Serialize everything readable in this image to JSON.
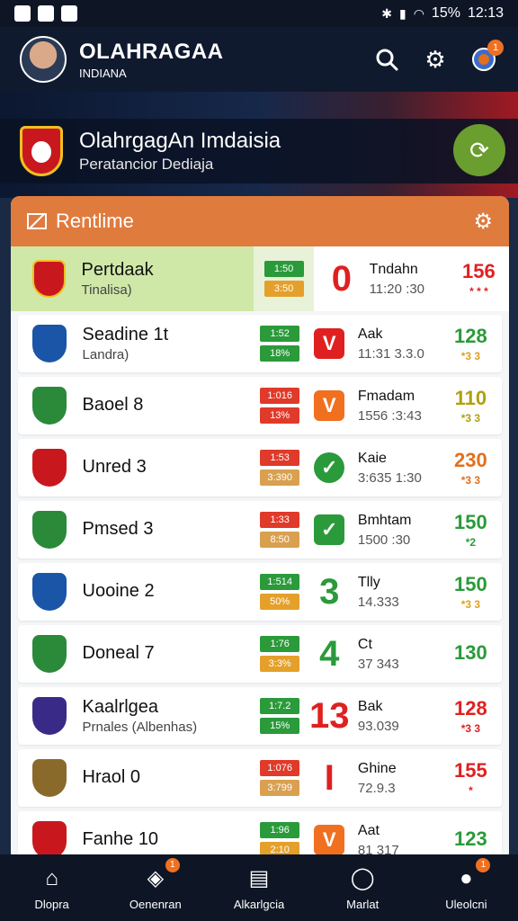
{
  "status_bar": {
    "time": "12:13",
    "battery": "15%"
  },
  "header": {
    "title": "OLAHRAGAA",
    "subtitle": "INDIANA",
    "notification_count": "1",
    "icons": [
      "search-icon",
      "gear-icon",
      "profile-icon"
    ]
  },
  "hero": {
    "title": "OlahrgagAn Imdaisia",
    "subtitle": "Peratancior Dediaja"
  },
  "panel": {
    "title": "Rentlime",
    "featured": {
      "team": "Pertdaak",
      "sub": "Tinalisa)",
      "pill_top": "1:50",
      "pill_bottom": "3:50",
      "indicator": "0",
      "opponent": "Tndahn",
      "opponent_sub": "11:20 :30",
      "score": "156",
      "score_sub": "* * *",
      "color": "#e02020"
    },
    "rows": [
      {
        "team": "Seadine 1t",
        "sub": "Landra)",
        "pill_top": "1:52",
        "pill_bottom": "18%",
        "indicator_type": "box",
        "indicator": "V",
        "opponent": "Aak",
        "opponent_sub": "11:31 3.3.0",
        "score": "128",
        "score_sub": "*3 3",
        "color": "#2a9a3a",
        "badge": "#1a55a8"
      },
      {
        "team": "Baoel 8",
        "sub": "",
        "pill_top": "1:016",
        "pill_bottom": "13%",
        "indicator_type": "box",
        "indicator": "V",
        "opponent": "Fmadam",
        "opponent_sub": "1556 :3:43",
        "score": "110",
        "score_sub": "*3 3",
        "color": "#b0a010",
        "badge": "#2a8a3a"
      },
      {
        "team": "Unred 3",
        "sub": "",
        "pill_top": "1:53",
        "pill_bottom": "3:390",
        "indicator_type": "circle",
        "indicator": "✓",
        "opponent": "Kaie",
        "opponent_sub": "3:635 1:30",
        "score": "230",
        "score_sub": "*3 3",
        "color": "#e07020",
        "badge": "#c8181e"
      },
      {
        "team": "Pmsed 3",
        "sub": "",
        "pill_top": "1:33",
        "pill_bottom": "8:50",
        "indicator_type": "box",
        "indicator": "✓",
        "opponent": "Bmhtam",
        "opponent_sub": "1500 :30",
        "score": "150",
        "score_sub": "*2",
        "color": "#2a9a3a",
        "badge": "#2a8a3a"
      },
      {
        "team": "Uooine 2",
        "sub": "",
        "pill_top": "1:514",
        "pill_bottom": "50%",
        "indicator_type": "num",
        "indicator": "3",
        "opponent": "Tlly",
        "opponent_sub": "14.333",
        "score": "150",
        "score_sub": "*3 3",
        "color": "#2a9a3a",
        "badge": "#1a55a8"
      },
      {
        "team": "Doneal 7",
        "sub": "",
        "pill_top": "1:76",
        "pill_bottom": "3:3%",
        "indicator_type": "num",
        "indicator": "4",
        "opponent": "Ct",
        "opponent_sub": "37 343",
        "score": "130",
        "score_sub": "",
        "color": "#2a9a3a",
        "badge": "#2a8a3a"
      },
      {
        "team": "Kaalrlgea",
        "sub": "Prnales (Albenhas)",
        "pill_top": "1:7.2",
        "pill_bottom": "15%",
        "indicator_type": "num",
        "indicator": "13",
        "opponent": "Bak",
        "opponent_sub": "93.039",
        "score": "128",
        "score_sub": "*3 3",
        "color": "#e02020",
        "badge": "#3a2a88"
      },
      {
        "team": "Hraol 0",
        "sub": "",
        "pill_top": "1:076",
        "pill_bottom": "3:799",
        "indicator_type": "num",
        "indicator": "I",
        "opponent": "Ghine",
        "opponent_sub": "72.9.3",
        "score": "155",
        "score_sub": "*",
        "color": "#e02020",
        "badge": "#8a6a2a"
      },
      {
        "team": "Fanhe 10",
        "sub": "",
        "pill_top": "1:96",
        "pill_bottom": "2:10",
        "indicator_type": "box",
        "indicator": "V",
        "opponent": "Aat",
        "opponent_sub": "81 317",
        "score": "123",
        "score_sub": "",
        "color": "#2a9a3a",
        "badge": "#c8181e"
      }
    ]
  },
  "nav": [
    {
      "label": "Dlopra",
      "icon": "home-icon",
      "badge": ""
    },
    {
      "label": "Oenenran",
      "icon": "shield-icon",
      "badge": "1"
    },
    {
      "label": "Alkarlgcia",
      "icon": "chart-icon",
      "badge": ""
    },
    {
      "label": "Marlat",
      "icon": "person-icon",
      "badge": ""
    },
    {
      "label": "Uleolcni",
      "icon": "profile-icon",
      "badge": "1"
    }
  ]
}
